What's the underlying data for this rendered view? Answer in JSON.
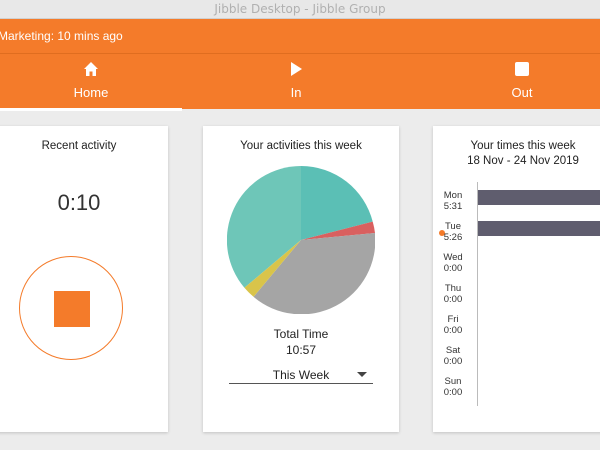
{
  "window": {
    "title": "Jibble Desktop - Jibble Group"
  },
  "status": {
    "text": "Marketing: 10 mins ago"
  },
  "nav": {
    "tabs": [
      {
        "label": "Home",
        "icon": "home-icon",
        "active": true
      },
      {
        "label": "In",
        "icon": "play-icon"
      },
      {
        "label": "Out",
        "icon": "stop-icon"
      }
    ]
  },
  "recent": {
    "title": "Recent activity",
    "timer": "0:10"
  },
  "activities": {
    "title": "Your activities this week",
    "total_label": "Total Time",
    "total_value": "10:57",
    "period": "This Week"
  },
  "times": {
    "title": "Your times this week",
    "range": "18 Nov - 24 Nov 2019",
    "days": [
      {
        "day": "Mon",
        "time": "5:31"
      },
      {
        "day": "Tue",
        "time": "5:26"
      },
      {
        "day": "Wed",
        "time": "0:00"
      },
      {
        "day": "Thu",
        "time": "0:00"
      },
      {
        "day": "Fri",
        "time": "0:00"
      },
      {
        "day": "Sat",
        "time": "0:00"
      },
      {
        "day": "Sun",
        "time": "0:00"
      }
    ]
  },
  "colors": {
    "accent": "#f47b2a",
    "pie_teal": "#5bbfb5",
    "pie_red": "#d9605f",
    "pie_gray": "#a5a5a5",
    "pie_yellow": "#d9c44a",
    "bar": "#5f5d6e"
  }
}
